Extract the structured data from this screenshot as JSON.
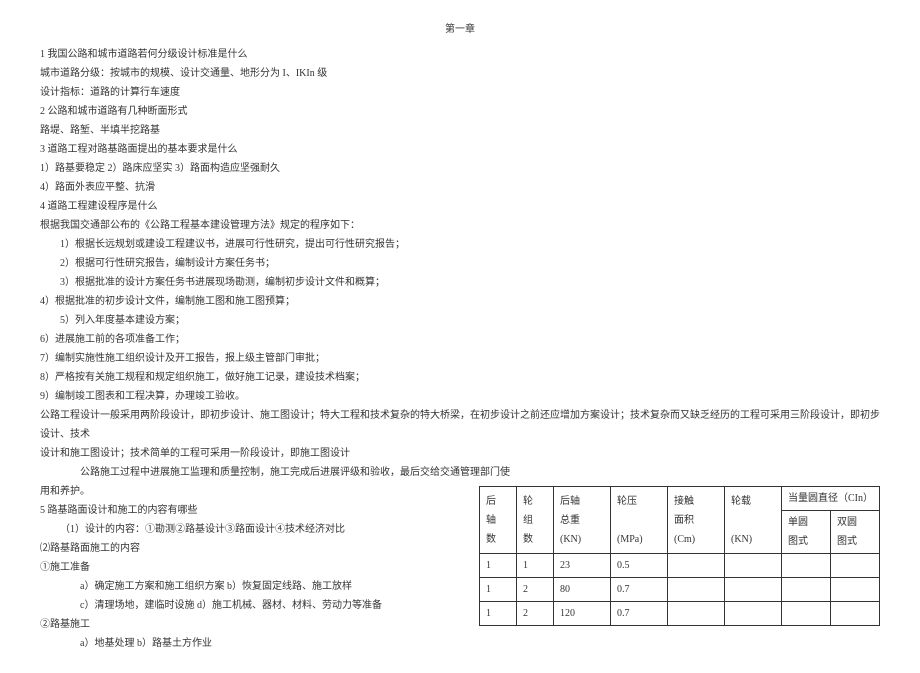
{
  "title": "第一章",
  "lines": {
    "l1": "1 我国公路和城市道路若何分级设计标准是什么",
    "l2": "城市道路分级：按城市的规模、设计交通量、地形分为 I、IKIn 级",
    "l3": "设计指标：道路的计算行车速度",
    "l4": "2 公路和城市道路有几种断面形式",
    "l5": "路堤、路堑、半填半挖路基",
    "l6": "3 道路工程对路基路面提出的基本要求是什么",
    "l7": "1）路基要稳定 2）路床应坚实 3）路面构造应坚强耐久",
    "l8": "4）路面外表应平整、抗滑",
    "l9": "4 道路工程建设程序是什么",
    "l10": "根据我国交通部公布的《公路工程基本建设管理方法》规定的程序如下：",
    "l11": "1）根据长远规划或建设工程建议书，进展可行性研究，提出可行性研究报告；",
    "l12": "2）根据可行性研究报告，编制设计方案任务书；",
    "l13": "3）根据批准的设计方案任务书进展现场勘测，编制初步设计文件和概算；",
    "l14": "4）根据批准的初步设计文件，编制施工图和施工图预算；",
    "l15": "5）列入年度基本建设方案；",
    "l16": "6）进展施工前的各项准备工作；",
    "l17": "7）编制实施性施工组织设计及开工报告，报上级主管部门审批；",
    "l18": "8）严格按有关施工规程和规定组织施工，做好施工记录，建设技术档案；",
    "l19": "9）编制竣工图表和工程决算，办理竣工验收。",
    "l20": "公路工程设计一般采用两阶段设计，即初步设计、施工图设计；特大工程和技术复杂的特大桥梁，在初步设计之前还应增加方案设计；技术复杂而又缺乏经历的工程可采用三阶段设计，即初步设计、技术",
    "l21": "设计和施工图设计；技术简单的工程可采用一阶段设计，即施工图设计",
    "l22": "公路施工过程中进展施工监理和质量控制，施工完成后进展评级和验收，最后交给交通管理部门使",
    "l23": "用和养护。",
    "l24": "5 路基路面设计和施工的内容有哪些",
    "l25": "（1）设计的内容：①勘测②路基设计③路面设计④技术经济对比",
    "l26": "⑵路基路面施工的内容",
    "l27": "①施工准备",
    "l28": "a）确定施工方案和施工组织方案 b）恢复固定线路、施工放样",
    "l29": "c）清理场地，建临时设施 d）施工机械、器材、材料、劳动力等准备",
    "l30": "②路基施工",
    "l31": "a）地基处理 b）路基土方作业"
  },
  "table": {
    "head": {
      "r1": {
        "c1": "后",
        "c2": "轮",
        "c3": "后轴",
        "c4": "轮压",
        "c5": "接触",
        "c6": "轮载",
        "c7": "当量圆直径（CIn）"
      },
      "r2": {
        "c1": "轴",
        "c2": "组",
        "c3": "总重",
        "c4": "",
        "c5": "面积",
        "c6": "",
        "c7": "单圆",
        "c8": "双圆"
      },
      "r3": {
        "c1": "数",
        "c2": "数",
        "c3": "(KN)",
        "c4": "(MPa)",
        "c5": "(Cm)",
        "c6": "(KN)",
        "c7": "图式",
        "c8": "图式"
      }
    },
    "body": {
      "r1": {
        "c1": "1",
        "c2": "1",
        "c3": "23",
        "c4": "0.5",
        "c5": "",
        "c6": "",
        "c7": "",
        "c8": ""
      },
      "r2": {
        "c1": "1",
        "c2": "2",
        "c3": "80",
        "c4": "0.7",
        "c5": "",
        "c6": "",
        "c7": "",
        "c8": ""
      },
      "r3": {
        "c1": "1",
        "c2": "2",
        "c3": "120",
        "c4": "0.7",
        "c5": "",
        "c6": "",
        "c7": "",
        "c8": ""
      }
    }
  }
}
